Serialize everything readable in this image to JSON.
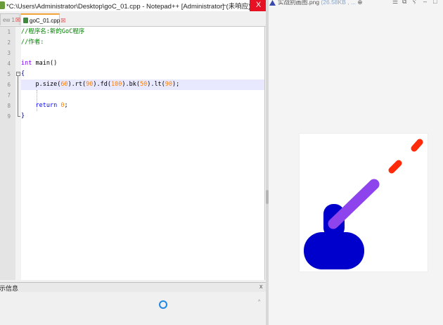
{
  "window": {
    "title": "*C:\\Users\\Administrator\\Desktop\\goC_01.cpp - Notepad++ [Administrator] (未响应)",
    "min_glyph": "–",
    "max_glyph": "□",
    "close_glyph": "X"
  },
  "tabs": [
    {
      "label": "ew 1",
      "close": "☒",
      "active": false
    },
    {
      "label": "goC_01.cpp",
      "close": "☒",
      "active": true
    }
  ],
  "editor": {
    "line_numbers": [
      "1",
      "2",
      "3",
      "4",
      "5",
      "6",
      "7",
      "8",
      "9"
    ],
    "lines": {
      "l1": "//程序名:新的GoC程序",
      "l2": "//作者:",
      "l4_kw": "int",
      "l4_rest": " main()",
      "l5": "{",
      "l6": {
        "indent": "    ",
        "p1": "p.size(",
        "n1": "60",
        "p2": ").rt(",
        "n2": "90",
        "p3": ").fd(",
        "n3": "100",
        "p4": ").bk(",
        "n4": "50",
        "p5": ").lt(",
        "n5": "90",
        "p6": ");"
      },
      "l8_kw": "return",
      "l8_num": "0",
      "l8_end": ";",
      "l9": "}"
    },
    "current_line": 6
  },
  "output_panel": {
    "title": "示信息",
    "close": "x",
    "scroll_up": "^"
  },
  "viewer": {
    "title": "实战别画图.png",
    "size_text": "(26.58KB , ...",
    "extra": "⊕",
    "buttons": [
      "☰",
      "⧉",
      "Ⲋ",
      "–",
      "□"
    ]
  },
  "drawing": {
    "tank_color": "#0000cc",
    "barrel_color": "#8e44ed",
    "shell_color": "#ff2a0a"
  }
}
